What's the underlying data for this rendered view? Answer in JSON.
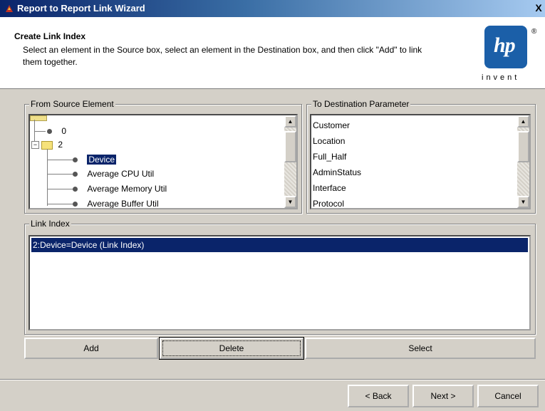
{
  "window": {
    "title": "Report to Report Link Wizard",
    "close_label": "X"
  },
  "header": {
    "title": "Create Link Index",
    "description": "Select an element in the Source box, select an element in the Destination box, and then click \"Add\" to link them together.",
    "logo_mark": "hp",
    "logo_tagline": "invent",
    "logo_reg": "®"
  },
  "source": {
    "label": "From Source Element",
    "items": [
      "0",
      "2",
      "Device",
      "Average CPU Util",
      "Average Memory Util",
      "Average Buffer Util"
    ],
    "selected": "Device"
  },
  "destination": {
    "label": "To Destination Parameter",
    "items": [
      "Customer",
      "Location",
      "Full_Half",
      "AdminStatus",
      "Interface",
      "Protocol"
    ]
  },
  "link_index": {
    "label": "Link Index",
    "items": [
      "2:Device=Device (Link Index)"
    ]
  },
  "actions": {
    "add": "Add",
    "delete": "Delete",
    "select": "Select"
  },
  "nav": {
    "back": "< Back",
    "next": "Next >",
    "cancel": "Cancel"
  },
  "colors": {
    "selection": "#0a246a",
    "hp_blue": "#1b5fa8",
    "dialog_bg": "#d4d0c8"
  }
}
